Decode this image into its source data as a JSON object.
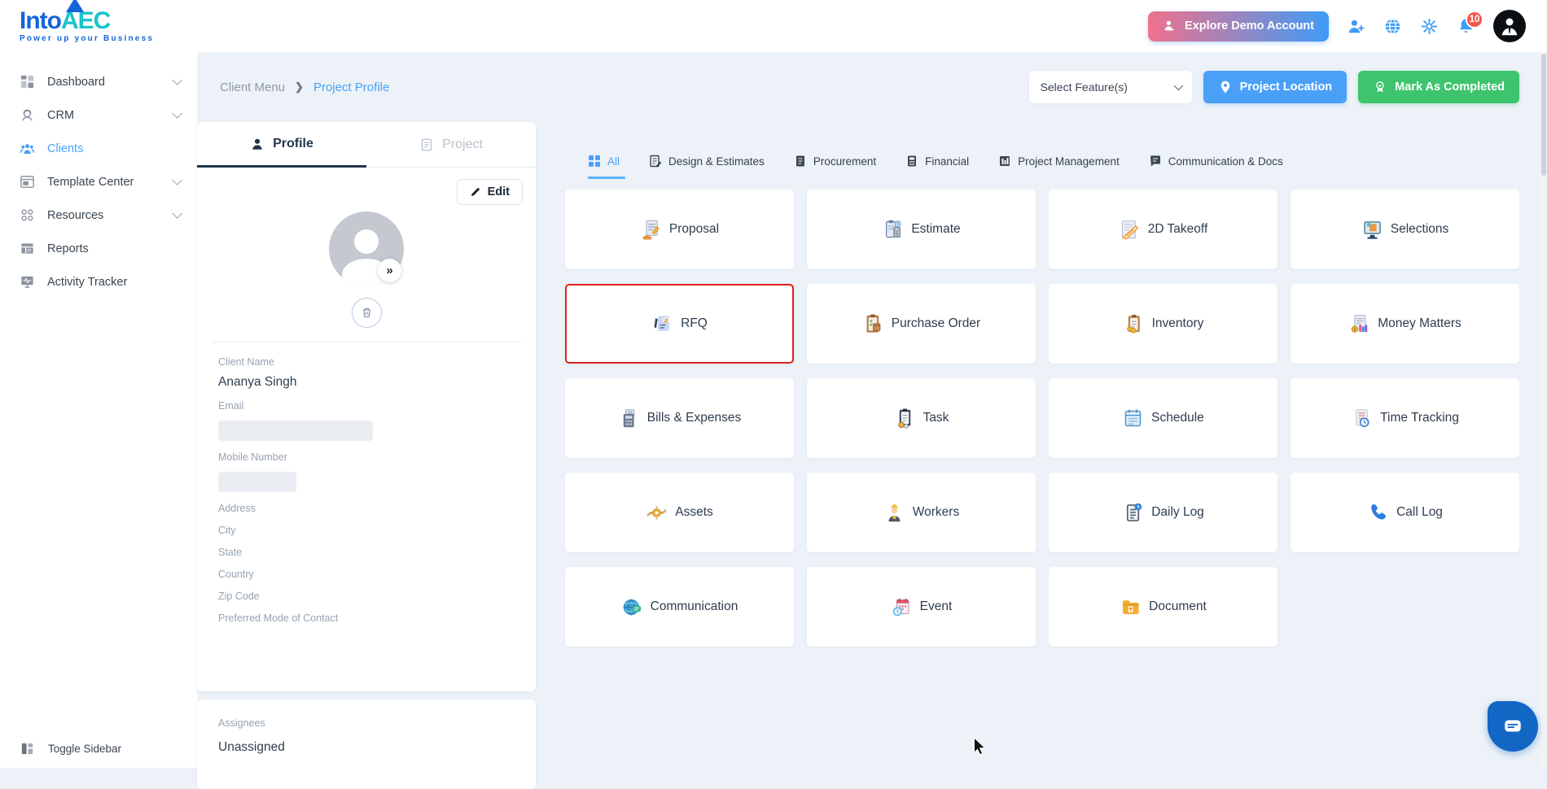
{
  "brand": {
    "into": "Into",
    "aec": "AEC",
    "tagline": "Power up your Business"
  },
  "header": {
    "explore_button": "Explore Demo Account",
    "notification_count": "10",
    "icons": [
      "person-add-icon",
      "globe-icon",
      "settings-icon",
      "notifications-icon",
      "user-avatar"
    ]
  },
  "sidebar": {
    "items": [
      {
        "label": "Dashboard",
        "icon": "dashboard-grid-icon",
        "chevron": true,
        "active": false
      },
      {
        "label": "CRM",
        "icon": "crm-icon",
        "chevron": true,
        "active": false
      },
      {
        "label": "Clients",
        "icon": "clients-icon",
        "chevron": false,
        "active": true
      },
      {
        "label": "Template Center",
        "icon": "template-icon",
        "chevron": true,
        "active": false
      },
      {
        "label": "Resources",
        "icon": "resources-icon",
        "chevron": true,
        "active": false
      },
      {
        "label": "Reports",
        "icon": "reports-icon",
        "chevron": false,
        "active": false
      },
      {
        "label": "Activity Tracker",
        "icon": "activity-icon",
        "chevron": false,
        "active": false
      }
    ],
    "toggle_label": "Toggle Sidebar"
  },
  "breadcrumb": {
    "section": "Client Menu",
    "page": "Project Profile"
  },
  "actions": {
    "select_features": "Select Feature(s)",
    "project_location": "Project Location",
    "mark_completed": "Mark As Completed"
  },
  "profile": {
    "tabs": [
      {
        "label": "Profile",
        "active": true
      },
      {
        "label": "Project",
        "active": false
      }
    ],
    "edit_label": "Edit",
    "fields": [
      {
        "label": "Client Name",
        "value": "Ananya Singh",
        "redacted": false
      },
      {
        "label": "Email",
        "value": "",
        "redacted": true
      },
      {
        "label": "Mobile Number",
        "value": "",
        "redacted": true
      },
      {
        "label": "Address",
        "value": "",
        "redacted": false
      },
      {
        "label": "City",
        "value": "",
        "redacted": false
      },
      {
        "label": "State",
        "value": "",
        "redacted": false
      },
      {
        "label": "Country",
        "value": "",
        "redacted": false
      },
      {
        "label": "Zip Code",
        "value": "",
        "redacted": false
      },
      {
        "label": "Preferred Mode of Contact",
        "value": "",
        "redacted": false
      }
    ],
    "assignees_label": "Assignees",
    "assignees_value": "Unassigned"
  },
  "feature_tabs": [
    {
      "label": "All",
      "active": true
    },
    {
      "label": "Design & Estimates",
      "active": false
    },
    {
      "label": "Procurement",
      "active": false
    },
    {
      "label": "Financial",
      "active": false
    },
    {
      "label": "Project Management",
      "active": false
    },
    {
      "label": "Communication & Docs",
      "active": false
    }
  ],
  "features": [
    {
      "label": "Proposal",
      "icon": "proposal-icon",
      "highlighted": false
    },
    {
      "label": "Estimate",
      "icon": "estimate-icon",
      "highlighted": false
    },
    {
      "label": "2D Takeoff",
      "icon": "takeoff-icon",
      "highlighted": false
    },
    {
      "label": "Selections",
      "icon": "selections-icon",
      "highlighted": false
    },
    {
      "label": "RFQ",
      "icon": "rfq-icon",
      "highlighted": true
    },
    {
      "label": "Purchase Order",
      "icon": "purchase-order-icon",
      "highlighted": false
    },
    {
      "label": "Inventory",
      "icon": "inventory-icon",
      "highlighted": false
    },
    {
      "label": "Money Matters",
      "icon": "money-matters-icon",
      "highlighted": false
    },
    {
      "label": "Bills & Expenses",
      "icon": "bills-expenses-icon",
      "highlighted": false
    },
    {
      "label": "Task",
      "icon": "task-icon",
      "highlighted": false
    },
    {
      "label": "Schedule",
      "icon": "schedule-icon",
      "highlighted": false
    },
    {
      "label": "Time Tracking",
      "icon": "time-tracking-icon",
      "highlighted": false
    },
    {
      "label": "Assets",
      "icon": "assets-icon",
      "highlighted": false
    },
    {
      "label": "Workers",
      "icon": "workers-icon",
      "highlighted": false
    },
    {
      "label": "Daily Log",
      "icon": "daily-log-icon",
      "highlighted": false
    },
    {
      "label": "Call Log",
      "icon": "call-log-icon",
      "highlighted": false
    },
    {
      "label": "Communication",
      "icon": "communication-icon",
      "highlighted": false
    },
    {
      "label": "Event",
      "icon": "event-icon",
      "highlighted": false
    },
    {
      "label": "Document",
      "icon": "document-icon",
      "highlighted": false
    }
  ],
  "colors": {
    "accent_blue": "#4aa0f7",
    "success_green": "#3ec46d",
    "gradient_pink": "#f0718c",
    "badge_red": "#f4564e",
    "rfq_highlight_border": "#e02020",
    "brand_blue": "#1565d8",
    "brand_teal": "#19c3c9",
    "page_background": "#edf2f8"
  }
}
